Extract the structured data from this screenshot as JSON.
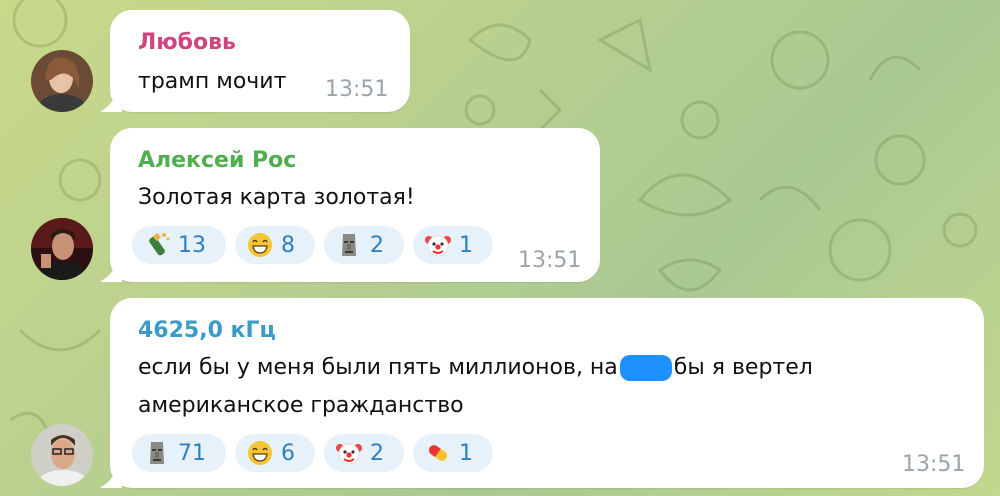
{
  "messages": [
    {
      "sender": "Любовь",
      "sender_color": "#d0457f",
      "text": "трамп мочит",
      "time": "13:51",
      "reactions": []
    },
    {
      "sender": "Алексей Рос",
      "sender_color": "#4fae4e",
      "text": "Золотая карта золотая!",
      "time": "13:51",
      "reactions": [
        {
          "emoji": "champagne-icon",
          "count": "13"
        },
        {
          "emoji": "grinning-face-icon",
          "count": "8"
        },
        {
          "emoji": "moai-icon",
          "count": "2"
        },
        {
          "emoji": "clown-face-icon",
          "count": "1"
        }
      ]
    },
    {
      "sender": "4625,0 кГц",
      "sender_color": "#3a9bc4",
      "text_before": "если бы у меня были пять миллионов, на",
      "text_after": "бы я вертел",
      "text_line2": "американское гражданство",
      "time": "13:51",
      "reactions": [
        {
          "emoji": "moai-icon",
          "count": "71"
        },
        {
          "emoji": "grinning-face-icon",
          "count": "6"
        },
        {
          "emoji": "clown-face-icon",
          "count": "2"
        },
        {
          "emoji": "pill-icon",
          "count": "1"
        }
      ]
    }
  ],
  "colors": {
    "reaction_bg": "#e6f1fa",
    "reaction_count": "#2f7fc0",
    "time": "#9aa3ac",
    "redaction": "#1e90ff"
  }
}
